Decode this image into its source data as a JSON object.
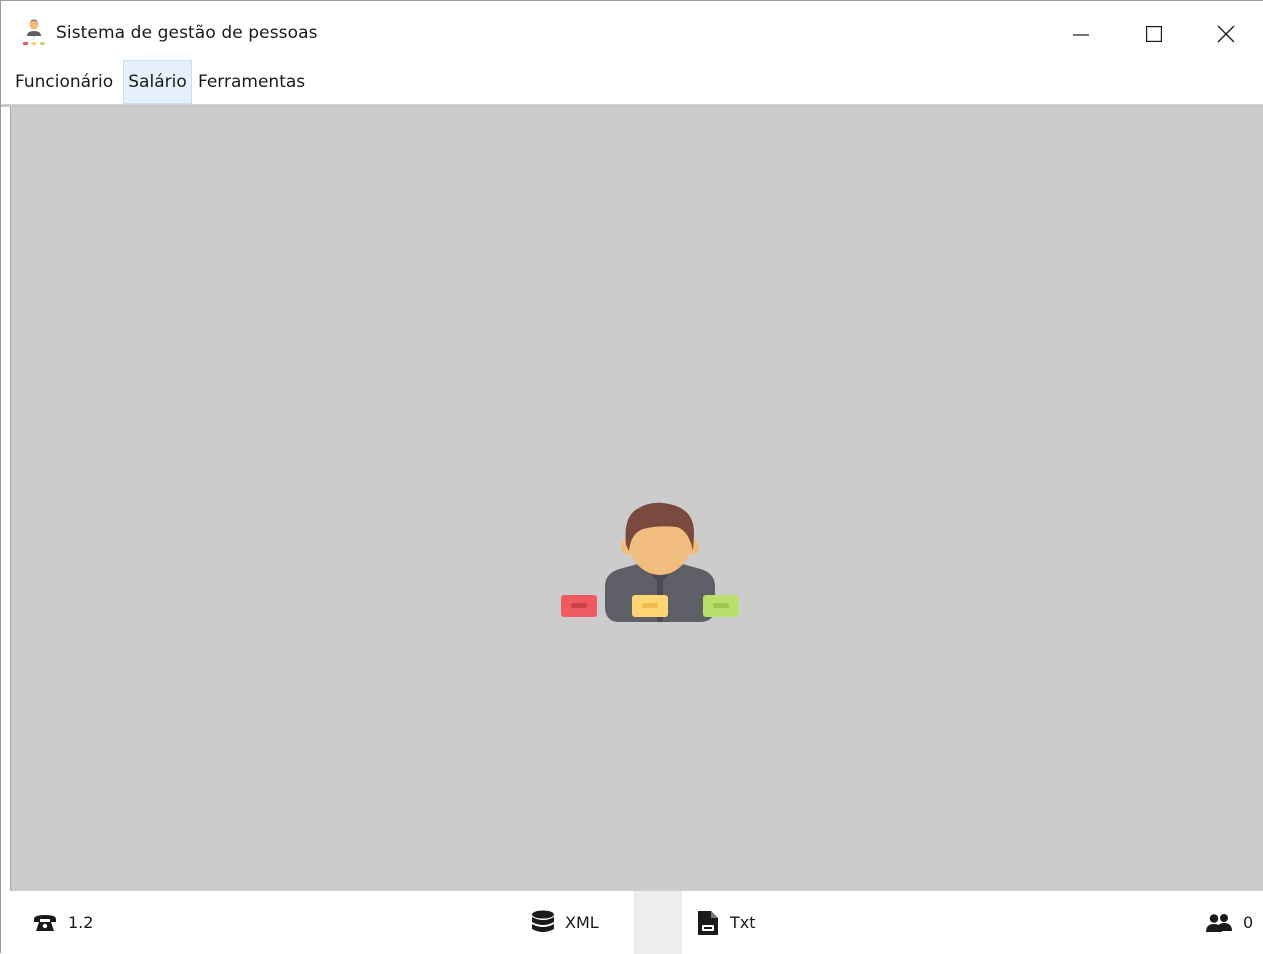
{
  "window": {
    "title": "Sistema de gestão de pessoas",
    "controls": [
      "minimize",
      "maximize",
      "close"
    ]
  },
  "menu": {
    "items": [
      {
        "label": "Funcionário"
      },
      {
        "label": "Salário",
        "state": "hover"
      },
      {
        "label": "Ferramentas"
      }
    ]
  },
  "main": {
    "background_color": "#cccccc",
    "logo_icon": "person-org-chart-icon",
    "logo_colors": {
      "hair": "#7a4a3e",
      "skin": "#f0bd7e",
      "suit": "#5e5e66",
      "connector": "#eef1f5",
      "box_red": "#ee5a5f",
      "box_yellow": "#ffd475",
      "box_green": "#b9e06c"
    }
  },
  "statusbar": {
    "version": {
      "icon": "phone-icon",
      "value": "1.2"
    },
    "storage": {
      "icon": "database-icon",
      "label": "XML"
    },
    "file": {
      "icon": "document-icon",
      "label": "Txt"
    },
    "users": {
      "icon": "users-icon",
      "count": "0"
    }
  }
}
